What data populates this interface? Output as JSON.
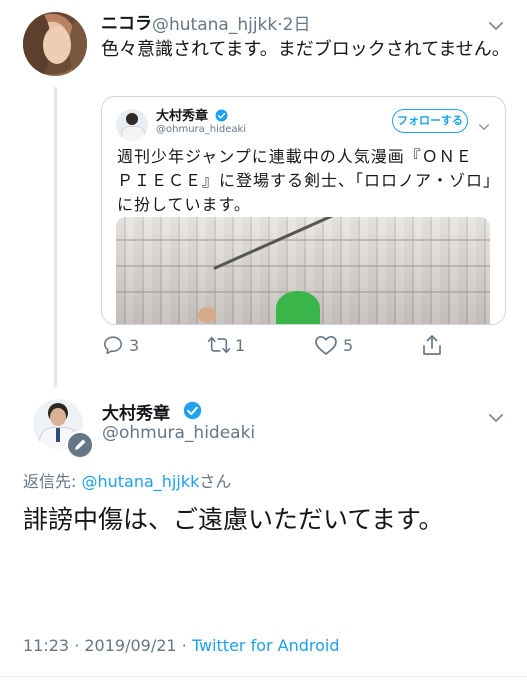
{
  "parent_tweet": {
    "display_name": "ニコラ",
    "handle": "@hutana_hjjkk",
    "separator": "·",
    "time": "2日",
    "text": "色々意識されてます。まだブロックされてません。"
  },
  "quoted_tweet": {
    "display_name": "大村秀章",
    "handle": "@ohmura_hideaki",
    "follow_label": "フォローする",
    "text": "週刊少年ジャンプに連載中の人気漫画『ＯＮＥ　ＰＩＥＣＥ』に登場する剣士、「ロロノア・ゾロ」に扮しています。"
  },
  "actions": {
    "reply_count": "3",
    "retweet_count": "1",
    "like_count": "5"
  },
  "main_tweet": {
    "display_name": "大村秀章",
    "handle": "@ohmura_hideaki",
    "reply_to_label": "返信先: ",
    "reply_to_handle": "@hutana_hjjkk",
    "reply_to_suffix": "さん",
    "text": "誹謗中傷は、ご遠慮いただいてます。",
    "time": "11:23",
    "dot": " · ",
    "date": "2019/09/21",
    "dot2": " · ",
    "source": "Twitter for Android"
  },
  "colors": {
    "accent": "#1da1f2",
    "secondary_text": "#657786",
    "text": "#14171a",
    "border": "#ccd6dd"
  },
  "icons": [
    "chevron-down-icon",
    "verified-badge-icon",
    "reply-icon",
    "retweet-icon",
    "like-icon",
    "share-icon",
    "edit-pencil-icon"
  ]
}
